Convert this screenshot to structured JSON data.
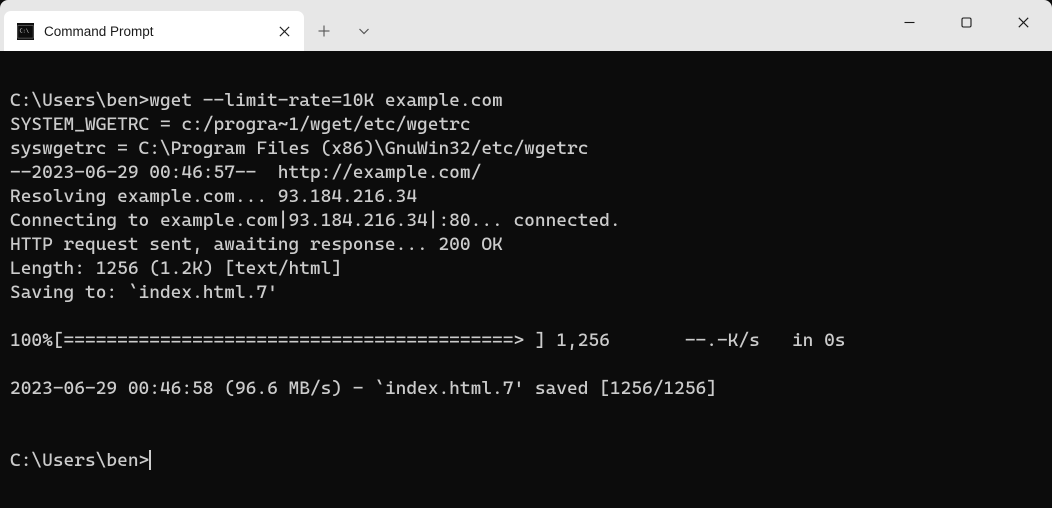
{
  "tab": {
    "title": "Command Prompt"
  },
  "terminal": {
    "lines": [
      "",
      "C:\\Users\\ben>wget --limit-rate=10K example.com",
      "SYSTEM_WGETRC = c:/progra~1/wget/etc/wgetrc",
      "syswgetrc = C:\\Program Files (x86)\\GnuWin32/etc/wgetrc",
      "--2023-06-29 00:46:57--  http://example.com/",
      "Resolving example.com... 93.184.216.34",
      "Connecting to example.com|93.184.216.34|:80... connected.",
      "HTTP request sent, awaiting response... 200 OK",
      "Length: 1256 (1.2K) [text/html]",
      "Saving to: `index.html.7'",
      "",
      "100%[==========================================> ] 1,256       --.-K/s   in 0s",
      "",
      "2023-06-29 00:46:58 (96.6 MB/s) - `index.html.7' saved [1256/1256]",
      "",
      ""
    ],
    "prompt": "C:\\Users\\ben>"
  }
}
